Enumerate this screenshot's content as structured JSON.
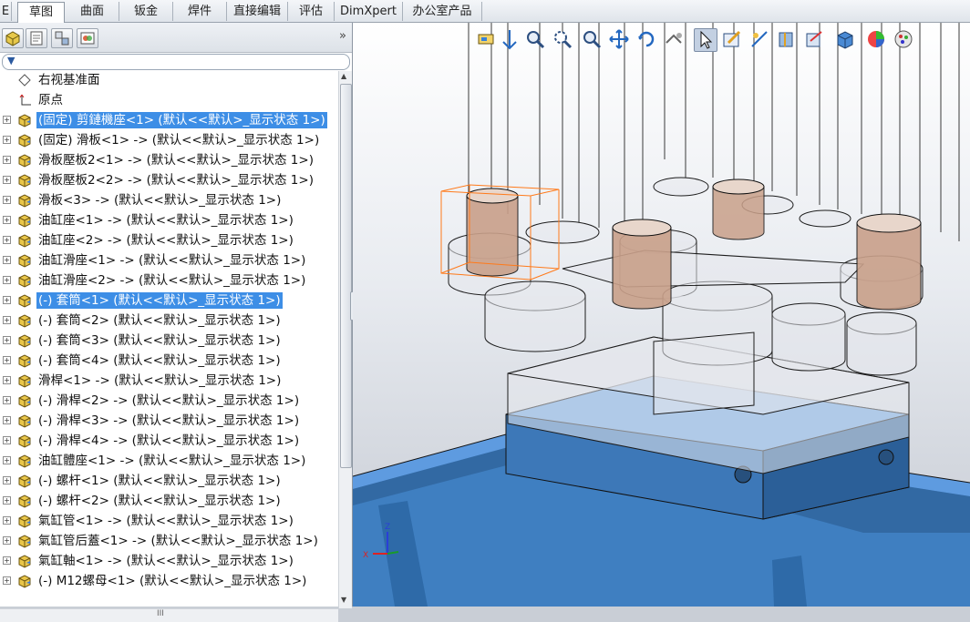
{
  "ribbon_tabs": [
    {
      "label": "E"
    },
    {
      "label": "草图",
      "active": true
    },
    {
      "label": "曲面"
    },
    {
      "label": "钣金"
    },
    {
      "label": "焊件"
    },
    {
      "label": "直接编辑"
    },
    {
      "label": "评估"
    },
    {
      "label": "DimXpert"
    },
    {
      "label": "办公室产品"
    }
  ],
  "panel": {
    "tab_icons": [
      "feature-tree-icon",
      "property-manager-icon",
      "configuration-manager-icon",
      "display-manager-icon"
    ],
    "more_label": "»",
    "filter_icon": "filter-icon"
  },
  "tree": [
    {
      "label": "右视基准面",
      "icon": "plane-icon",
      "expand": false
    },
    {
      "label": "原点",
      "icon": "origin-icon",
      "expand": false
    },
    {
      "label": "(固定) 剪鏈機座<1> (默认<<默认>_显示状态 1>)",
      "icon": "part-icon",
      "expand": true,
      "selected": true
    },
    {
      "label": "(固定) 滑板<1> -> (默认<<默认>_显示状态 1>)",
      "icon": "part-icon",
      "expand": true
    },
    {
      "label": "滑板壓板2<1> -> (默认<<默认>_显示状态 1>)",
      "icon": "part-icon",
      "expand": true
    },
    {
      "label": "滑板壓板2<2> -> (默认<<默认>_显示状态 1>)",
      "icon": "part-icon",
      "expand": true
    },
    {
      "label": "滑板<3> -> (默认<<默认>_显示状态 1>)",
      "icon": "part-icon",
      "expand": true
    },
    {
      "label": "油缸座<1> -> (默认<<默认>_显示状态 1>)",
      "icon": "part-icon",
      "expand": true
    },
    {
      "label": "油缸座<2> -> (默认<<默认>_显示状态 1>)",
      "icon": "part-icon",
      "expand": true
    },
    {
      "label": "油缸滑座<1> -> (默认<<默认>_显示状态 1>)",
      "icon": "part-icon",
      "expand": true
    },
    {
      "label": "油缸滑座<2> -> (默认<<默认>_显示状态 1>)",
      "icon": "part-icon",
      "expand": true
    },
    {
      "label": "(-) 套筒<1> (默认<<默认>_显示状态 1>)",
      "icon": "part-icon",
      "expand": true,
      "selected": true
    },
    {
      "label": "(-) 套筒<2> (默认<<默认>_显示状态 1>)",
      "icon": "part-icon",
      "expand": true
    },
    {
      "label": "(-) 套筒<3> (默认<<默认>_显示状态 1>)",
      "icon": "part-icon",
      "expand": true
    },
    {
      "label": "(-) 套筒<4> (默认<<默认>_显示状态 1>)",
      "icon": "part-icon",
      "expand": true
    },
    {
      "label": "滑桿<1> -> (默认<<默认>_显示状态 1>)",
      "icon": "part-icon",
      "expand": true
    },
    {
      "label": "(-) 滑桿<2> -> (默认<<默认>_显示状态 1>)",
      "icon": "part-icon",
      "expand": true
    },
    {
      "label": "(-) 滑桿<3> -> (默认<<默认>_显示状态 1>)",
      "icon": "part-icon",
      "expand": true
    },
    {
      "label": "(-) 滑桿<4> -> (默认<<默认>_显示状态 1>)",
      "icon": "part-icon",
      "expand": true
    },
    {
      "label": "油缸體座<1> -> (默认<<默认>_显示状态 1>)",
      "icon": "part-icon",
      "expand": true
    },
    {
      "label": "(-) 螺杆<1> (默认<<默认>_显示状态 1>)",
      "icon": "part-icon",
      "expand": true
    },
    {
      "label": "(-) 螺杆<2> (默认<<默认>_显示状态 1>)",
      "icon": "part-icon",
      "expand": true
    },
    {
      "label": "氣缸管<1> -> (默认<<默认>_显示状态 1>)",
      "icon": "part-icon",
      "expand": true
    },
    {
      "label": "氣缸管后蓋<1> -> (默认<<默认>_显示状态 1>)",
      "icon": "part-icon",
      "expand": true
    },
    {
      "label": "氣缸軸<1> -> (默认<<默认>_显示状态 1>)",
      "icon": "part-icon",
      "expand": true
    },
    {
      "label": "(-) M12螺母<1> (默认<<默认>_显示状态 1>)",
      "icon": "part-icon",
      "expand": true
    }
  ],
  "scroll": {
    "up": "▲",
    "down": "▼",
    "hmark": "III"
  },
  "hud_icons": [
    "zoom-to-fit-icon",
    "zoom-to-area-icon",
    "zoom-in-out-icon",
    "zoom-to-selection-icon",
    "rotate-view-icon",
    "pan-icon",
    "rotate-icon",
    "roll-view-icon",
    "select-arrow-icon",
    "sketch-icon",
    "smart-dimension-icon",
    "section-view-icon",
    "view-orientation-icon",
    "display-style-icon",
    "appearance-icon",
    "scene-icon"
  ],
  "triad": {
    "x": "X",
    "y": "Y",
    "z": "Z"
  },
  "colors": {
    "selection": "#3d8ee6",
    "table_blue": "#3f7fc1",
    "sleeve": "#c9a08a"
  }
}
